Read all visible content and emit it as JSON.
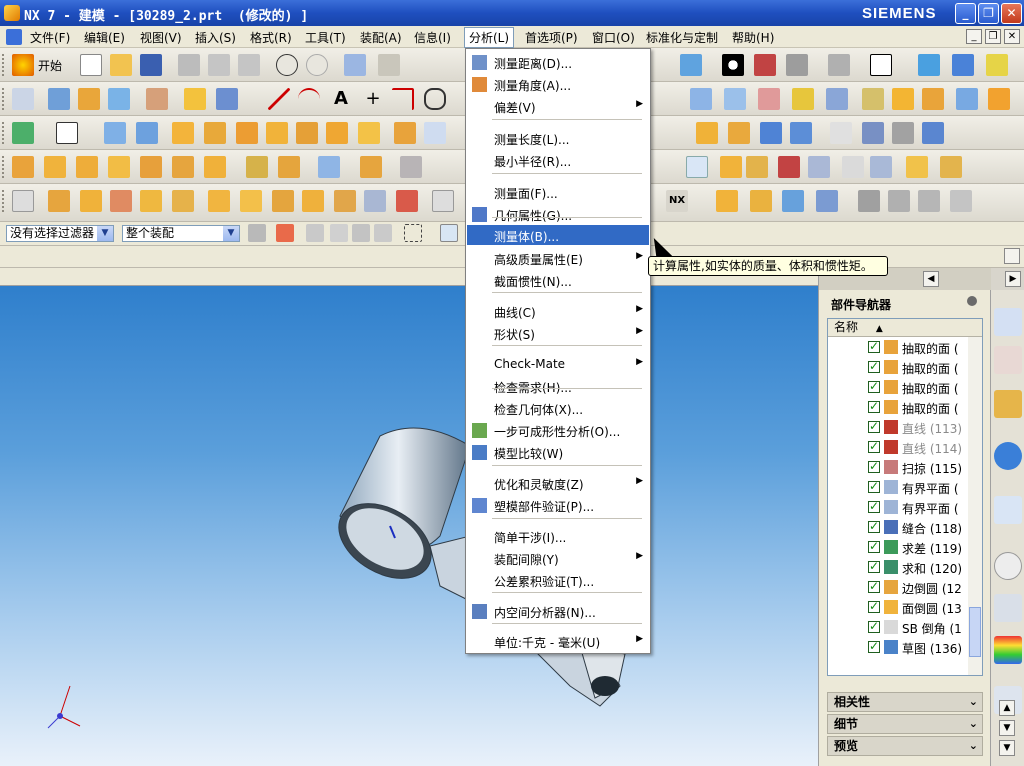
{
  "window": {
    "title": "NX 7 - 建模 - [30289_2.prt  (修改的) ]",
    "brand": "SIEMENS"
  },
  "menubar": {
    "items": [
      "文件(F)",
      "编辑(E)",
      "视图(V)",
      "插入(S)",
      "格式(R)",
      "工具(T)",
      "装配(A)",
      "信息(I)",
      "分析(L)",
      "首选项(P)",
      "窗口(O)",
      "标准化与定制",
      "帮助(H)"
    ],
    "active": "分析(L)"
  },
  "toolbar": {
    "start_label": "开始"
  },
  "filterbar": {
    "filter_value": "没有选择过滤器",
    "scope_value": "整个装配"
  },
  "analysis_menu": {
    "items": [
      {
        "label": "测量距离(D)...",
        "icon": "measure-distance-icon"
      },
      {
        "label": "测量角度(A)...",
        "icon": "measure-angle-icon"
      },
      {
        "label": "偏差(V)",
        "submenu": true
      },
      {
        "label": "测量长度(L)..."
      },
      {
        "label": "最小半径(R)..."
      },
      {
        "label": "测量面(F)..."
      },
      {
        "label": "几何属性(G)...",
        "icon": "geometric-properties-icon"
      },
      {
        "label": "测量体(B)...",
        "highlighted": true
      },
      {
        "label": "高级质量属性(E)",
        "submenu": true
      },
      {
        "label": "截面惯性(N)..."
      },
      {
        "label": "曲线(C)",
        "submenu": true
      },
      {
        "label": "形状(S)",
        "submenu": true
      },
      {
        "label": "Check-Mate",
        "submenu": true
      },
      {
        "label": "检查需求(H)..."
      },
      {
        "label": "检查几何体(X)..."
      },
      {
        "label": "一步可成形性分析(O)...",
        "icon": "one-step-formability-icon"
      },
      {
        "label": "模型比较(W)",
        "icon": "model-compare-icon"
      },
      {
        "label": "优化和灵敏度(Z)",
        "submenu": true
      },
      {
        "label": "塑模部件验证(P)...",
        "icon": "mold-part-validation-icon"
      },
      {
        "label": "简单干涉(I)..."
      },
      {
        "label": "装配间隙(Y)",
        "submenu": true
      },
      {
        "label": "公差累积验证(T)..."
      },
      {
        "label": "内空间分析器(N)...",
        "icon": "interior-space-analyzer-icon"
      },
      {
        "label": "单位:千克 - 毫米(U)",
        "submenu": true
      }
    ],
    "tooltip": "计算属性,如实体的质量、体积和惯性矩。"
  },
  "part_navigator": {
    "title": "部件导航器",
    "column_name": "名称",
    "rows": [
      {
        "label": "抽取的面 (",
        "icon": "extract-face-icon"
      },
      {
        "label": "抽取的面 (",
        "icon": "extract-face-icon"
      },
      {
        "label": "抽取的面 (",
        "icon": "extract-face-icon"
      },
      {
        "label": "抽取的面 (",
        "icon": "extract-face-icon"
      },
      {
        "label": "直线 (113)",
        "icon": "line-icon",
        "gray": true
      },
      {
        "label": "直线 (114)",
        "icon": "line-icon",
        "gray": true
      },
      {
        "label": "扫掠 (115)",
        "icon": "swept-icon"
      },
      {
        "label": "有界平面 (",
        "icon": "bounded-plane-icon"
      },
      {
        "label": "有界平面 (",
        "icon": "bounded-plane-icon"
      },
      {
        "label": "缝合 (118)",
        "icon": "sew-icon"
      },
      {
        "label": "求差 (119)",
        "icon": "subtract-icon"
      },
      {
        "label": "求和 (120)",
        "icon": "unite-icon"
      },
      {
        "label": "边倒圆 (12",
        "icon": "edge-blend-icon"
      },
      {
        "label": "面倒圆 (13",
        "icon": "face-blend-icon"
      },
      {
        "label": "SB 倒角 (1",
        "icon": "sb-chamfer-icon"
      },
      {
        "label": "草图 (136)",
        "icon": "sketch-icon"
      }
    ],
    "sections": [
      "相关性",
      "细节",
      "预览"
    ]
  },
  "colors": {
    "title_bar": "#1f4fbf",
    "menu_highlight": "#316ac5",
    "viewport_top": "#2f7fcc"
  }
}
